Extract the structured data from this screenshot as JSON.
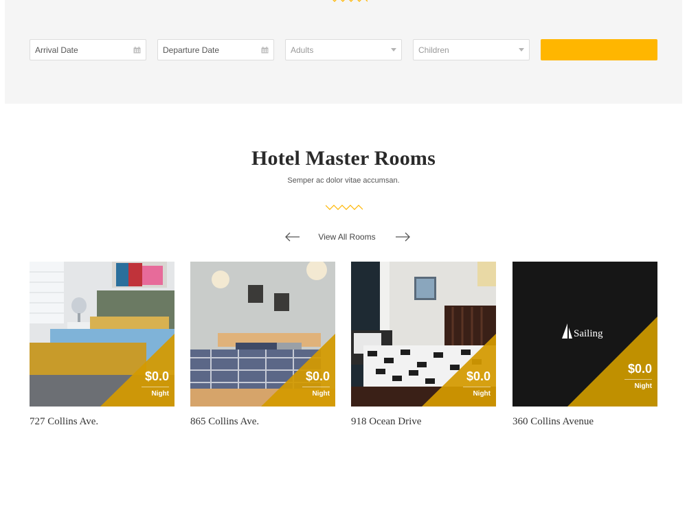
{
  "booking": {
    "arrival_placeholder": "Arrival Date",
    "departure_placeholder": "Departure Date",
    "adults_placeholder": "Adults",
    "children_placeholder": "Children",
    "submit_label": ""
  },
  "section": {
    "title": "Hotel Master Rooms",
    "subtitle": "Semper ac dolor vitae accumsan.",
    "view_all": "View All Rooms"
  },
  "rooms": [
    {
      "name": "727 Collins Ave.",
      "price": "$0.0",
      "per": "Night"
    },
    {
      "name": "865 Collins Ave.",
      "price": "$0.0",
      "per": "Night"
    },
    {
      "name": "918 Ocean Drive",
      "price": "$0.0",
      "per": "Night"
    },
    {
      "name": "360 Collins Avenue",
      "price": "$0.0",
      "per": "Night",
      "logo_text": "Sailing"
    }
  ],
  "colors": {
    "accent": "#ffb600",
    "price_overlay": "#d49a00",
    "booking_bg": "#f5f5f5"
  },
  "icons": {
    "calendar": "calendar-icon",
    "select": "chevron-down-icon",
    "prev": "arrow-left-icon",
    "next": "arrow-right-icon",
    "wave": "wave-divider-icon"
  }
}
